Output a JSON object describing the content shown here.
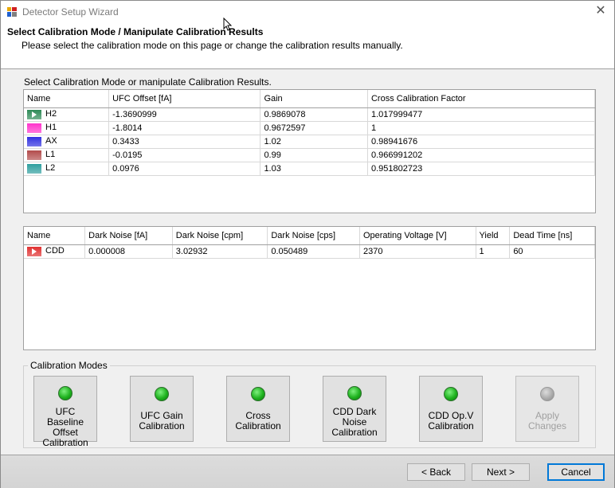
{
  "window": {
    "title": "Detector Setup Wizard"
  },
  "header": {
    "title": "Select Calibration Mode / Manipulate Calibration Results",
    "subtitle": "Please select the calibration mode on this page or change the calibration results manually."
  },
  "section_label": "Select Calibration Mode or manipulate Calibration Results.",
  "grid1": {
    "columns": [
      "Name",
      "UFC Offset [fA]",
      "Gain",
      "Cross Calibration Factor"
    ],
    "rows": [
      {
        "name": "H2",
        "color": "#2e8b57",
        "offset": "-1.3690999",
        "gain": "0.9869078",
        "ccf": "1.017999477",
        "selected": true
      },
      {
        "name": "H1",
        "color": "#ff33cc",
        "offset": "-1.8014",
        "gain": "0.9672597",
        "ccf": "1"
      },
      {
        "name": "AX",
        "color": "#3030e0",
        "offset": "0.3433",
        "gain": "1.02",
        "ccf": "0.98941676"
      },
      {
        "name": "L1",
        "color": "#b34b4b",
        "offset": "-0.0195",
        "gain": "0.99",
        "ccf": "0.966991202"
      },
      {
        "name": "L2",
        "color": "#2f9f9f",
        "offset": "0.0976",
        "gain": "1.03",
        "ccf": "0.951802723"
      }
    ]
  },
  "grid2": {
    "columns": [
      "Name",
      "Dark Noise [fA]",
      "Dark Noise [cpm]",
      "Dark Noise [cps]",
      "Operating Voltage [V]",
      "Yield",
      "Dead Time [ns]"
    ],
    "rows": [
      {
        "name": "CDD",
        "color": "#e03030",
        "dn_fa": "0.000008",
        "dn_cpm": "3.02932",
        "dn_cps": "0.050489",
        "voltage": "2370",
        "yield": "1",
        "dead_time": "60",
        "selected": true
      }
    ]
  },
  "modes": {
    "label": "Calibration Modes",
    "buttons": [
      {
        "label": "UFC Baseline Offset Calibration",
        "enabled": true
      },
      {
        "label": "UFC Gain Calibration",
        "enabled": true
      },
      {
        "label": "Cross Calibration",
        "enabled": true
      },
      {
        "label": "CDD Dark Noise Calibration",
        "enabled": true
      },
      {
        "label": "CDD Op.V Calibration",
        "enabled": true
      },
      {
        "label": "Apply Changes",
        "enabled": false
      }
    ]
  },
  "footer": {
    "back": "< Back",
    "next": "Next >",
    "cancel": "Cancel"
  }
}
